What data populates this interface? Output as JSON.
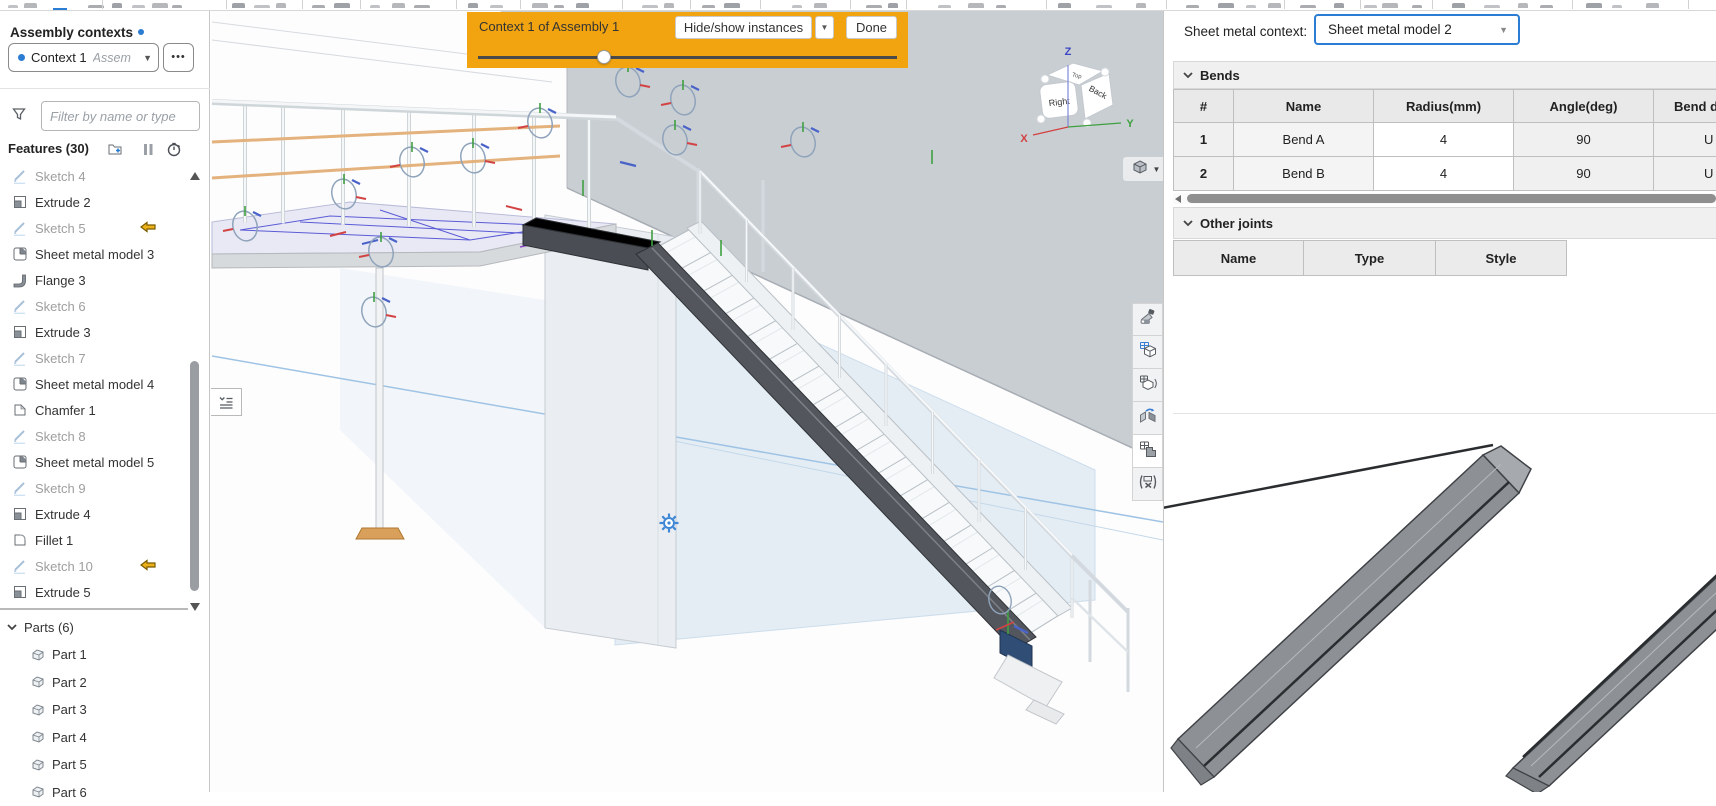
{
  "colors": {
    "accent_blue": "#2b7cd3",
    "banner_orange": "#f1a410",
    "selection_blue": "#2f4d75"
  },
  "left_panel": {
    "title": "Assembly contexts",
    "context_selector": {
      "value": "Context 1",
      "type_hint": "Assem",
      "menu": "•••"
    },
    "filter": {
      "placeholder": "Filter by name or type"
    },
    "features_header": "Features (30)",
    "features": [
      {
        "label": "Sketch 4",
        "icon": "sketch",
        "suppressed": true
      },
      {
        "label": "Extrude 2",
        "icon": "extrude"
      },
      {
        "label": "Sketch 5",
        "icon": "sketch",
        "suppressed": true,
        "arrow": true
      },
      {
        "label": "Sheet metal model 3",
        "icon": "sheetmetal"
      },
      {
        "label": "Flange 3",
        "icon": "flange"
      },
      {
        "label": "Sketch 6",
        "icon": "sketch",
        "suppressed": true
      },
      {
        "label": "Extrude 3",
        "icon": "extrude"
      },
      {
        "label": "Sketch 7",
        "icon": "sketch",
        "suppressed": true
      },
      {
        "label": "Sheet metal model 4",
        "icon": "sheetmetal"
      },
      {
        "label": "Chamfer 1",
        "icon": "chamfer"
      },
      {
        "label": "Sketch 8",
        "icon": "sketch",
        "suppressed": true
      },
      {
        "label": "Sheet metal model 5",
        "icon": "sheetmetal"
      },
      {
        "label": "Sketch 9",
        "icon": "sketch",
        "suppressed": true
      },
      {
        "label": "Extrude 4",
        "icon": "extrude"
      },
      {
        "label": "Fillet 1",
        "icon": "fillet"
      },
      {
        "label": "Sketch 10",
        "icon": "sketch",
        "suppressed": true,
        "arrow": true
      },
      {
        "label": "Extrude 5",
        "icon": "extrude"
      }
    ],
    "parts_header": "Parts (6)",
    "parts": [
      "Part 1",
      "Part 2",
      "Part 3",
      "Part 4",
      "Part 5",
      "Part 6"
    ]
  },
  "viewport": {
    "banner": {
      "title": "Context 1 of Assembly 1",
      "hide_show_label": "Hide/show instances",
      "done_label": "Done",
      "slider_percent": 30
    },
    "view_cube": {
      "face_top": "Top",
      "face_right": "Right",
      "face_back": "Back",
      "axis_x": "X",
      "axis_y": "Y",
      "axis_z": "Z"
    }
  },
  "right_panel": {
    "context_label": "Sheet metal context:",
    "context_value": "Sheet metal model 2",
    "bends": {
      "title": "Bends",
      "columns": [
        "#",
        "Name",
        "Radius(mm)",
        "Angle(deg)",
        "Bend d"
      ],
      "rows": [
        {
          "num": "1",
          "name": "Bend A",
          "radius": "4",
          "angle": "90",
          "direction": "U"
        },
        {
          "num": "2",
          "name": "Bend B",
          "radius": "4",
          "angle": "90",
          "direction": "U"
        }
      ]
    },
    "other_joints": {
      "title": "Other joints",
      "columns": [
        "Name",
        "Type",
        "Style"
      ]
    }
  }
}
